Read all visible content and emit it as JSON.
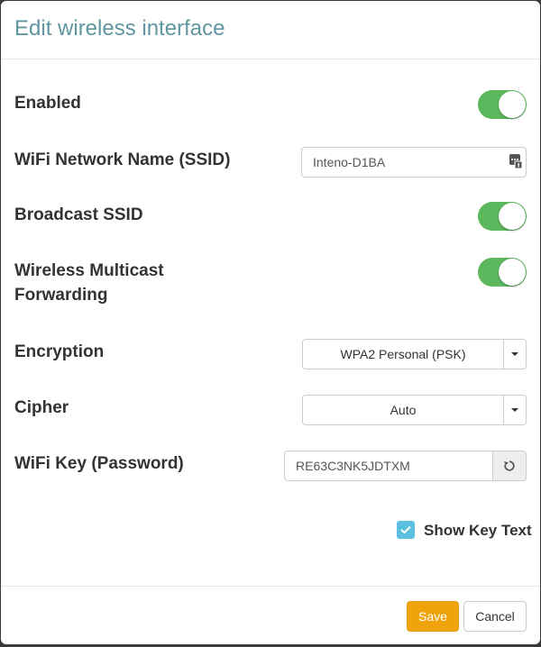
{
  "modal": {
    "title": "Edit wireless interface"
  },
  "fields": {
    "enabled": {
      "label": "Enabled",
      "value": true
    },
    "ssid": {
      "label": "WiFi Network Name (SSID)",
      "value": "Inteno-D1BA"
    },
    "broadcast_ssid": {
      "label": "Broadcast SSID",
      "value": true
    },
    "multicast": {
      "label_line1": "Wireless Multicast",
      "label_line2": "Forwarding",
      "value": true
    },
    "encryption": {
      "label": "Encryption",
      "selected": "WPA2 Personal (PSK)"
    },
    "cipher": {
      "label": "Cipher",
      "selected": "Auto"
    },
    "wifi_key": {
      "label": "WiFi Key (Password)",
      "value": "RE63C3NK5JDTXM"
    },
    "show_key": {
      "label": "Show Key Text",
      "checked": true
    }
  },
  "footer": {
    "save_label": "Save",
    "cancel_label": "Cancel"
  },
  "colors": {
    "toggle_on": "#5cb85c",
    "title": "#5f96a0",
    "save_button": "#f0a30a",
    "checkbox": "#5bc0de"
  },
  "icons": {
    "ssid_field": "text-snippet-icon",
    "key_button": "refresh-icon",
    "checkbox": "checkmark-icon",
    "select_caret": "caret-down-icon"
  }
}
